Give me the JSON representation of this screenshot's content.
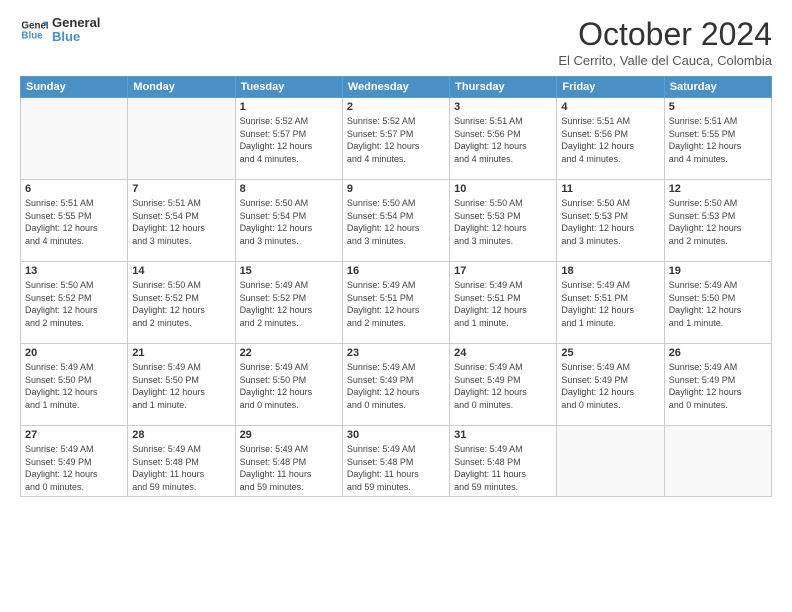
{
  "header": {
    "logo_line1": "General",
    "logo_line2": "Blue",
    "month_title": "October 2024",
    "location": "El Cerrito, Valle del Cauca, Colombia"
  },
  "weekdays": [
    "Sunday",
    "Monday",
    "Tuesday",
    "Wednesday",
    "Thursday",
    "Friday",
    "Saturday"
  ],
  "weeks": [
    [
      {
        "day": "",
        "info": ""
      },
      {
        "day": "",
        "info": ""
      },
      {
        "day": "1",
        "info": "Sunrise: 5:52 AM\nSunset: 5:57 PM\nDaylight: 12 hours\nand 4 minutes."
      },
      {
        "day": "2",
        "info": "Sunrise: 5:52 AM\nSunset: 5:57 PM\nDaylight: 12 hours\nand 4 minutes."
      },
      {
        "day": "3",
        "info": "Sunrise: 5:51 AM\nSunset: 5:56 PM\nDaylight: 12 hours\nand 4 minutes."
      },
      {
        "day": "4",
        "info": "Sunrise: 5:51 AM\nSunset: 5:56 PM\nDaylight: 12 hours\nand 4 minutes."
      },
      {
        "day": "5",
        "info": "Sunrise: 5:51 AM\nSunset: 5:55 PM\nDaylight: 12 hours\nand 4 minutes."
      }
    ],
    [
      {
        "day": "6",
        "info": "Sunrise: 5:51 AM\nSunset: 5:55 PM\nDaylight: 12 hours\nand 4 minutes."
      },
      {
        "day": "7",
        "info": "Sunrise: 5:51 AM\nSunset: 5:54 PM\nDaylight: 12 hours\nand 3 minutes."
      },
      {
        "day": "8",
        "info": "Sunrise: 5:50 AM\nSunset: 5:54 PM\nDaylight: 12 hours\nand 3 minutes."
      },
      {
        "day": "9",
        "info": "Sunrise: 5:50 AM\nSunset: 5:54 PM\nDaylight: 12 hours\nand 3 minutes."
      },
      {
        "day": "10",
        "info": "Sunrise: 5:50 AM\nSunset: 5:53 PM\nDaylight: 12 hours\nand 3 minutes."
      },
      {
        "day": "11",
        "info": "Sunrise: 5:50 AM\nSunset: 5:53 PM\nDaylight: 12 hours\nand 3 minutes."
      },
      {
        "day": "12",
        "info": "Sunrise: 5:50 AM\nSunset: 5:53 PM\nDaylight: 12 hours\nand 2 minutes."
      }
    ],
    [
      {
        "day": "13",
        "info": "Sunrise: 5:50 AM\nSunset: 5:52 PM\nDaylight: 12 hours\nand 2 minutes."
      },
      {
        "day": "14",
        "info": "Sunrise: 5:50 AM\nSunset: 5:52 PM\nDaylight: 12 hours\nand 2 minutes."
      },
      {
        "day": "15",
        "info": "Sunrise: 5:49 AM\nSunset: 5:52 PM\nDaylight: 12 hours\nand 2 minutes."
      },
      {
        "day": "16",
        "info": "Sunrise: 5:49 AM\nSunset: 5:51 PM\nDaylight: 12 hours\nand 2 minutes."
      },
      {
        "day": "17",
        "info": "Sunrise: 5:49 AM\nSunset: 5:51 PM\nDaylight: 12 hours\nand 1 minute."
      },
      {
        "day": "18",
        "info": "Sunrise: 5:49 AM\nSunset: 5:51 PM\nDaylight: 12 hours\nand 1 minute."
      },
      {
        "day": "19",
        "info": "Sunrise: 5:49 AM\nSunset: 5:50 PM\nDaylight: 12 hours\nand 1 minute."
      }
    ],
    [
      {
        "day": "20",
        "info": "Sunrise: 5:49 AM\nSunset: 5:50 PM\nDaylight: 12 hours\nand 1 minute."
      },
      {
        "day": "21",
        "info": "Sunrise: 5:49 AM\nSunset: 5:50 PM\nDaylight: 12 hours\nand 1 minute."
      },
      {
        "day": "22",
        "info": "Sunrise: 5:49 AM\nSunset: 5:50 PM\nDaylight: 12 hours\nand 0 minutes."
      },
      {
        "day": "23",
        "info": "Sunrise: 5:49 AM\nSunset: 5:49 PM\nDaylight: 12 hours\nand 0 minutes."
      },
      {
        "day": "24",
        "info": "Sunrise: 5:49 AM\nSunset: 5:49 PM\nDaylight: 12 hours\nand 0 minutes."
      },
      {
        "day": "25",
        "info": "Sunrise: 5:49 AM\nSunset: 5:49 PM\nDaylight: 12 hours\nand 0 minutes."
      },
      {
        "day": "26",
        "info": "Sunrise: 5:49 AM\nSunset: 5:49 PM\nDaylight: 12 hours\nand 0 minutes."
      }
    ],
    [
      {
        "day": "27",
        "info": "Sunrise: 5:49 AM\nSunset: 5:49 PM\nDaylight: 12 hours\nand 0 minutes."
      },
      {
        "day": "28",
        "info": "Sunrise: 5:49 AM\nSunset: 5:48 PM\nDaylight: 11 hours\nand 59 minutes."
      },
      {
        "day": "29",
        "info": "Sunrise: 5:49 AM\nSunset: 5:48 PM\nDaylight: 11 hours\nand 59 minutes."
      },
      {
        "day": "30",
        "info": "Sunrise: 5:49 AM\nSunset: 5:48 PM\nDaylight: 11 hours\nand 59 minutes."
      },
      {
        "day": "31",
        "info": "Sunrise: 5:49 AM\nSunset: 5:48 PM\nDaylight: 11 hours\nand 59 minutes."
      },
      {
        "day": "",
        "info": ""
      },
      {
        "day": "",
        "info": ""
      }
    ]
  ]
}
